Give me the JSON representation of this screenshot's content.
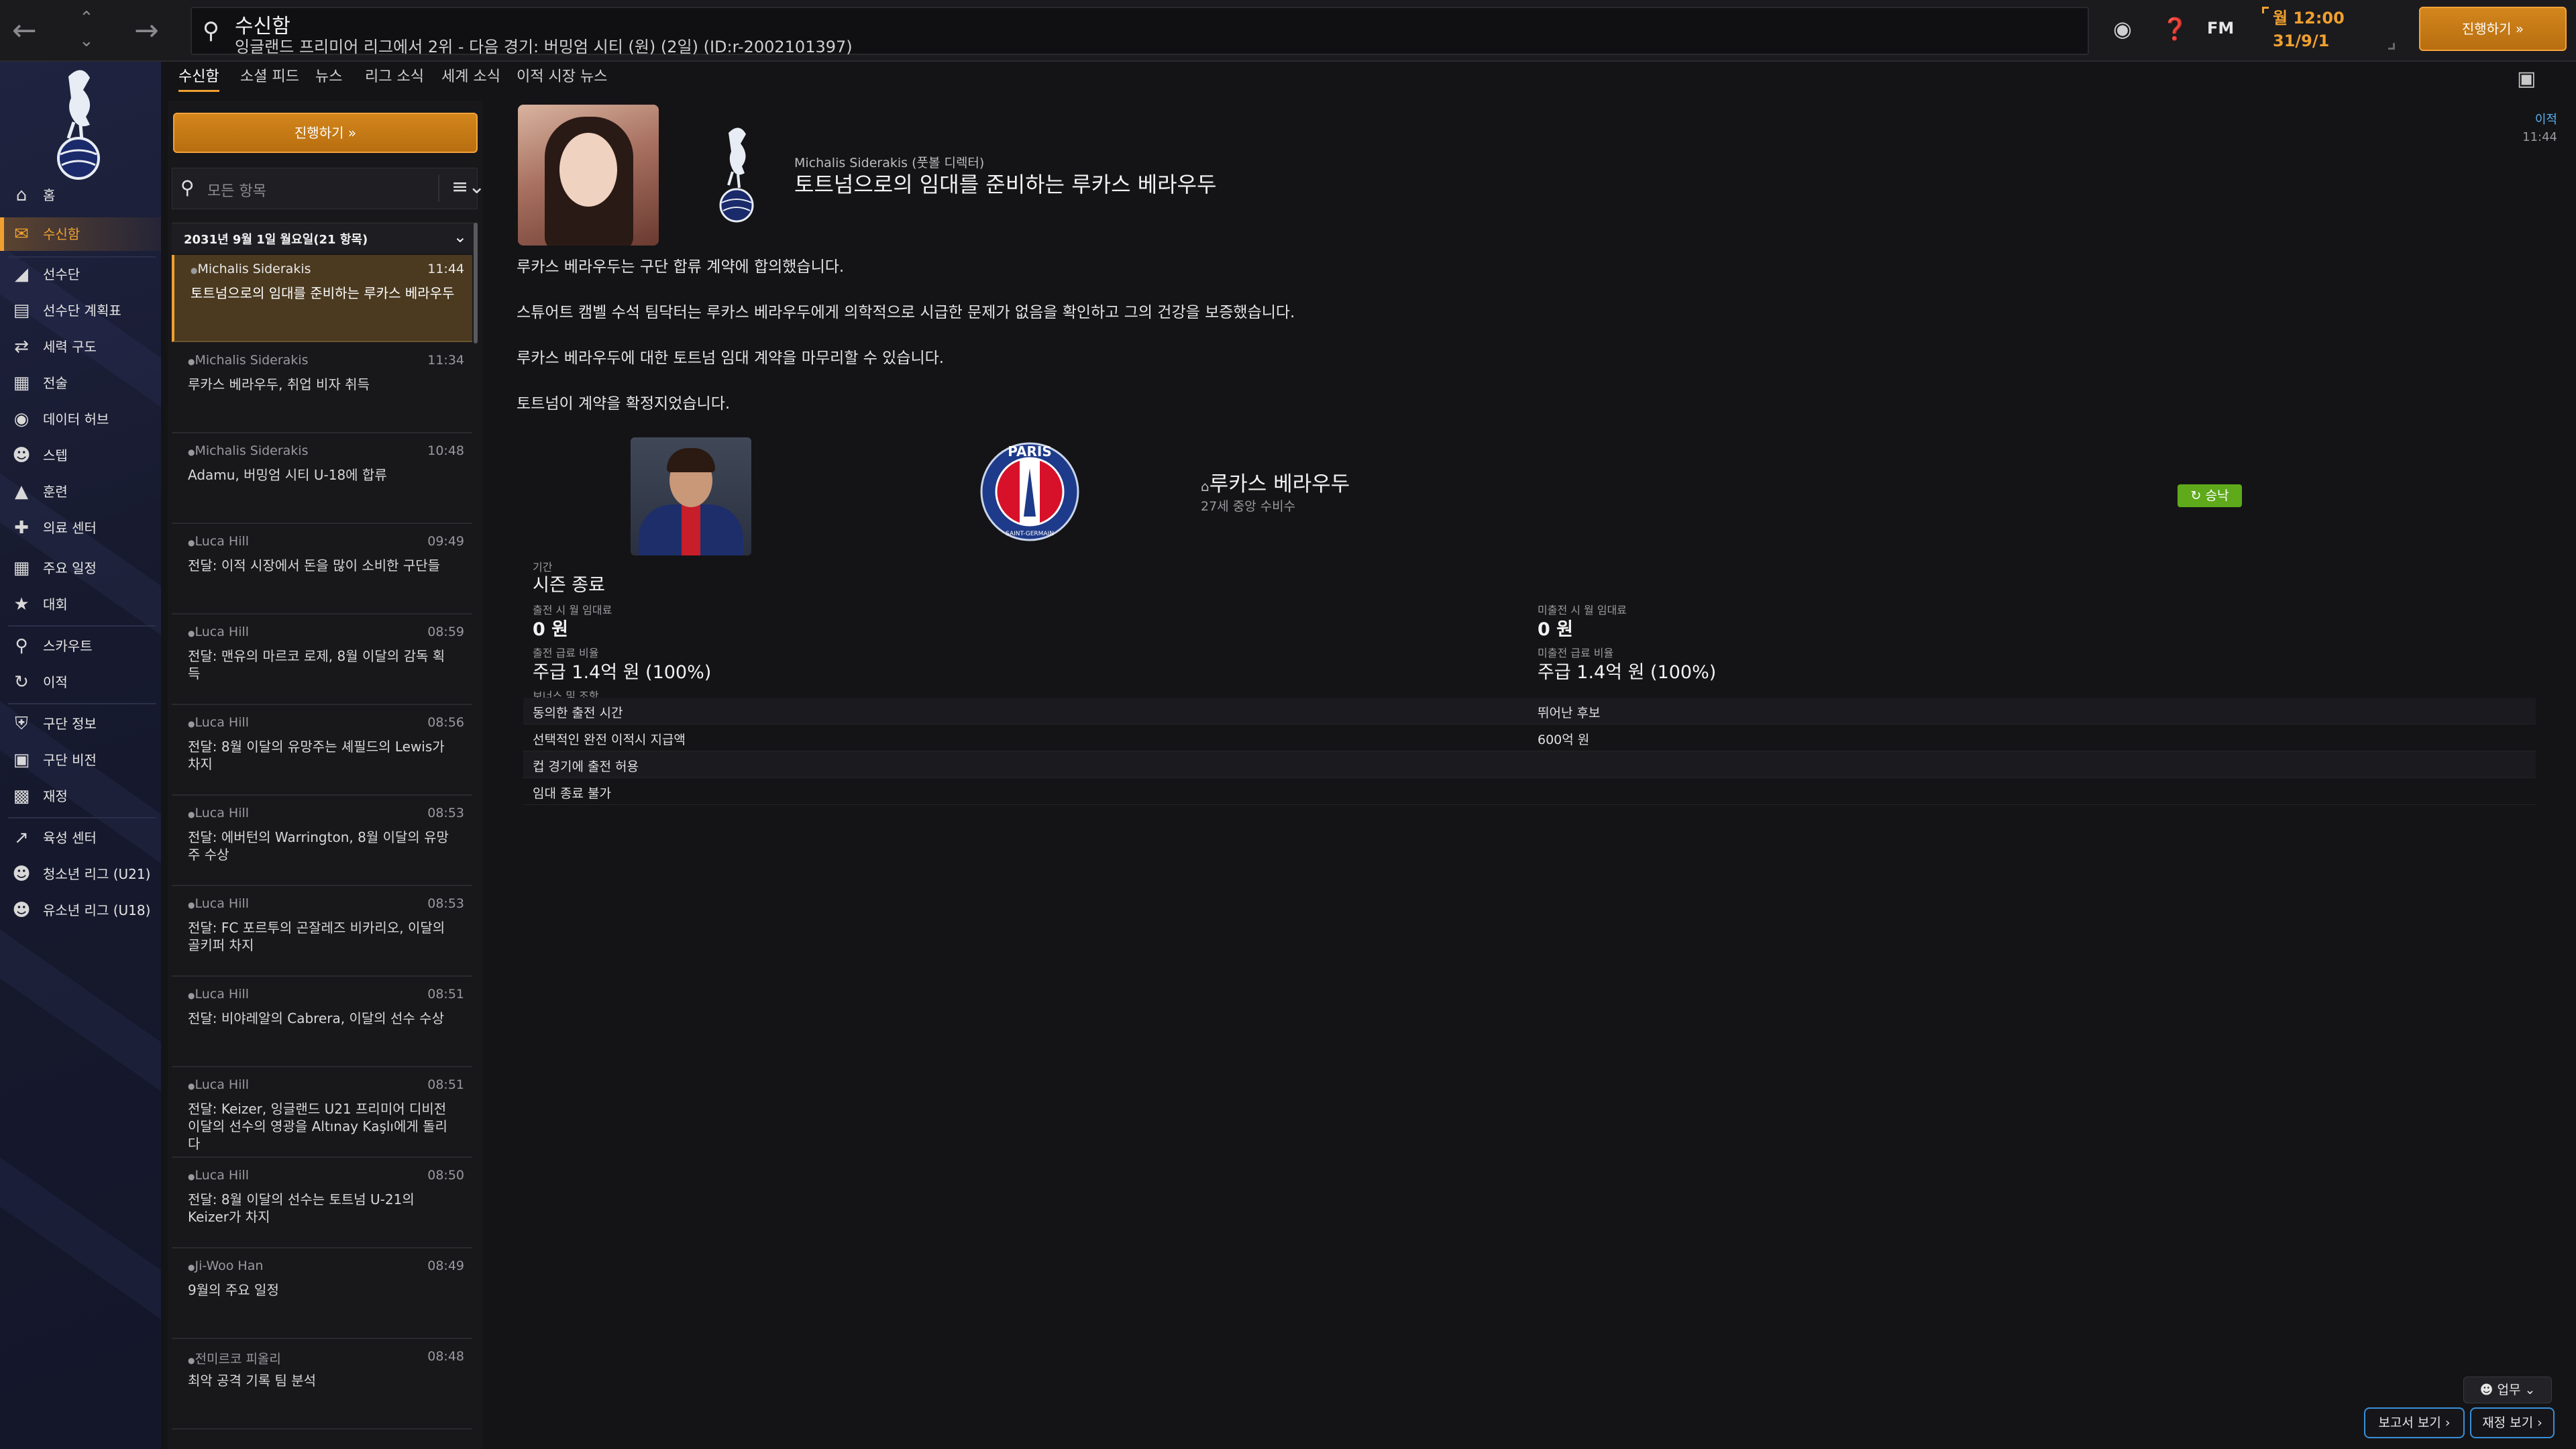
{
  "topbar": {
    "title": "수신함",
    "subtitle": "잉글랜드 프리미어 리그에서 2위 - 다음 경기: 버밍엄 시티 (원) (2일) (ID:r-2002101397)",
    "fm_label": "FM",
    "clock_time": "월 12:00",
    "clock_date": "31/9/1",
    "continue_label": "진행하기 »"
  },
  "sidebar": {
    "items": [
      {
        "label": "홈",
        "icon": "home-icon"
      },
      {
        "label": "수신함",
        "icon": "inbox-icon"
      },
      {
        "label": "선수단",
        "icon": "shirt-icon"
      },
      {
        "label": "선수단 계획표",
        "icon": "planner-icon"
      },
      {
        "label": "세력 구도",
        "icon": "dynamics-icon"
      },
      {
        "label": "전술",
        "icon": "tactics-icon"
      },
      {
        "label": "데이터 허브",
        "icon": "data-hub-icon"
      },
      {
        "label": "스텝",
        "icon": "staff-icon"
      },
      {
        "label": "훈련",
        "icon": "training-icon"
      },
      {
        "label": "의료 센터",
        "icon": "medical-icon"
      },
      {
        "label": "주요 일정",
        "icon": "calendar-icon"
      },
      {
        "label": "대회",
        "icon": "trophy-icon"
      },
      {
        "label": "스카우트",
        "icon": "scout-icon"
      },
      {
        "label": "이적",
        "icon": "transfer-icon"
      },
      {
        "label": "구단 정보",
        "icon": "club-info-icon"
      },
      {
        "label": "구단 비전",
        "icon": "club-vision-icon"
      },
      {
        "label": "재정",
        "icon": "finance-icon"
      },
      {
        "label": "육성 센터",
        "icon": "development-icon"
      },
      {
        "label": "청소년 리그 (U21)",
        "icon": "youth-u21-icon"
      },
      {
        "label": "유소년 리그 (U18)",
        "icon": "youth-u18-icon"
      }
    ]
  },
  "subtabs": [
    "수신함",
    "소셜 피드",
    "뉴스",
    "리그 소식",
    "세계 소식",
    "이적 시장 뉴스"
  ],
  "inbox": {
    "continue_label": "진행하기 »",
    "filter_placeholder": "모든 항목",
    "date_header": "2031년 9월 1일 월요일(21 항목)",
    "messages": [
      {
        "sender": "Michalis Siderakis",
        "time": "11:44",
        "subject": "토트넘으로의 임대를 준비하는 루카스 베라우두"
      },
      {
        "sender": "Michalis Siderakis",
        "time": "11:34",
        "subject": "루카스 베라우두, 취업 비자 취득"
      },
      {
        "sender": "Michalis Siderakis",
        "time": "10:48",
        "subject": "Adamu, 버밍엄 시티 U-18에 합류"
      },
      {
        "sender": "Luca Hill",
        "time": "09:49",
        "subject": "전달: 이적 시장에서 돈을 많이 소비한 구단들"
      },
      {
        "sender": "Luca Hill",
        "time": "08:59",
        "subject": "전달: 맨유의 마르코 로제, 8월 이달의 감독 획득"
      },
      {
        "sender": "Luca Hill",
        "time": "08:56",
        "subject": "전달: 8월 이달의 유망주는 셰필드의 Lewis가 차지"
      },
      {
        "sender": "Luca Hill",
        "time": "08:53",
        "subject": "전달: 에버턴의 Warrington, 8월 이달의 유망주 수상"
      },
      {
        "sender": "Luca Hill",
        "time": "08:53",
        "subject": "전달: FC 포르투의 곤잘레즈 비카리오, 이달의 골키퍼 차지"
      },
      {
        "sender": "Luca Hill",
        "time": "08:51",
        "subject": "전달: 비야레알의 Cabrera, 이달의 선수 수상"
      },
      {
        "sender": "Luca Hill",
        "time": "08:51",
        "subject": "전달: Keizer, 잉글랜드 U21 프리미어 디비전 이달의 선수의 영광을 Altınay Kaşlı에게 돌리다"
      },
      {
        "sender": "Luca Hill",
        "time": "08:50",
        "subject": "전달: 8월 이달의 선수는 토트넘 U-21의 Keizer가 차지"
      },
      {
        "sender": "Ji-Woo Han",
        "time": "08:49",
        "subject": "9월의 주요 일정"
      },
      {
        "sender": "전미르코 피올리",
        "time": "08:48",
        "subject": "최악 공격 기록 팀 분석"
      }
    ]
  },
  "detail": {
    "from": "Michalis Siderakis (풋볼 디렉터)",
    "title": "토트넘으로의 임대를 준비하는 루카스 베라우두",
    "unread_label": "이적",
    "unread_time": "11:44",
    "body": [
      "루카스 베라우두는 구단 합류 계약에 합의했습니다.",
      "스튜어트 캠벨 수석 팀닥터는 루카스 베라우두에게 의학적으로 시급한 문제가 없음을 확인하고 그의 건강을 보증했습니다.",
      "루카스 베라우두에 대한 토트넘 임대 계약을 마무리할 수 있습니다.",
      "토트넘이 계약을 확정지었습니다."
    ],
    "player_name": "루카스 베라우두",
    "player_sub": "27세 중앙 수비수",
    "status_badge": "승낙",
    "club_badge_text": "PARIS",
    "club_badge_sub": "SAINT-GERMAIN",
    "period_label": "기간",
    "period_value": "시즌 종료",
    "fee_play_label": "출전 시 월 임대료",
    "fee_play_value": "0 원",
    "fee_noplay_label": "미출전 시 월 임대료",
    "fee_noplay_value": "0 원",
    "wage_play_label": "출전 급료 비율",
    "wage_play_value": "주급 1.4억 원 (100%)",
    "wage_noplay_label": "미출전 급료 비율",
    "wage_noplay_value": "주급 1.4억 원 (100%)",
    "clauses_label": "보너스 및 조항",
    "clauses": [
      {
        "left": "동의한 출전 시간",
        "right": "뛰어난 후보"
      },
      {
        "left": "선택적인 완전 이적시 지급액",
        "right": "600억 원"
      },
      {
        "left": "컵 경기에 출전 허용",
        "right": ""
      },
      {
        "left": "임대 종료 불가",
        "right": ""
      }
    ]
  },
  "footer": {
    "work_label": "업무 ⌄",
    "report_label": "보고서 보기 ›",
    "finance_label": "재정 보기 ›"
  },
  "colors": {
    "accent": "#f0a030",
    "accept": "#5faa1a",
    "link": "#3a8fd8"
  }
}
